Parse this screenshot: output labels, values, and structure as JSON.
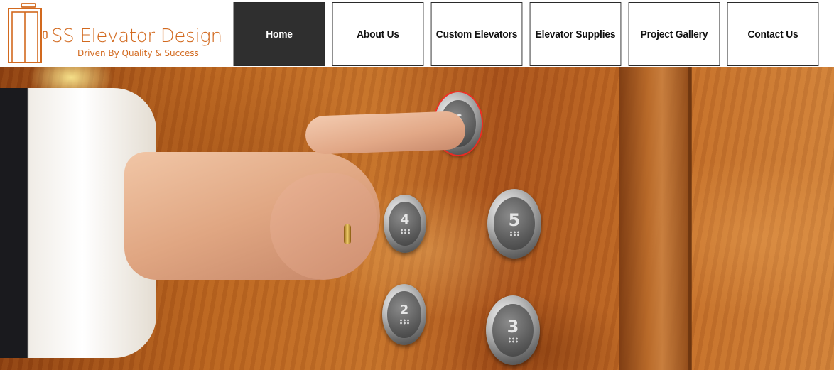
{
  "brand": {
    "name": "SS Elevator Design",
    "tagline": "Driven By Quality & Success",
    "logo_icon": "elevator-doors-icon",
    "color": "#d2691e"
  },
  "nav": {
    "active_color": "#2f2f2f",
    "items": [
      {
        "label": "Home",
        "active": true
      },
      {
        "label": "About Us",
        "active": false
      },
      {
        "label": "Custom Elevators",
        "active": false
      },
      {
        "label": "Elevator Supplies",
        "active": false
      },
      {
        "label": "Project Gallery",
        "active": false
      },
      {
        "label": "Contact Us",
        "active": false
      }
    ]
  },
  "hero": {
    "floor_buttons": [
      "6",
      "4",
      "5",
      "2",
      "3"
    ],
    "lit_button": "6"
  }
}
